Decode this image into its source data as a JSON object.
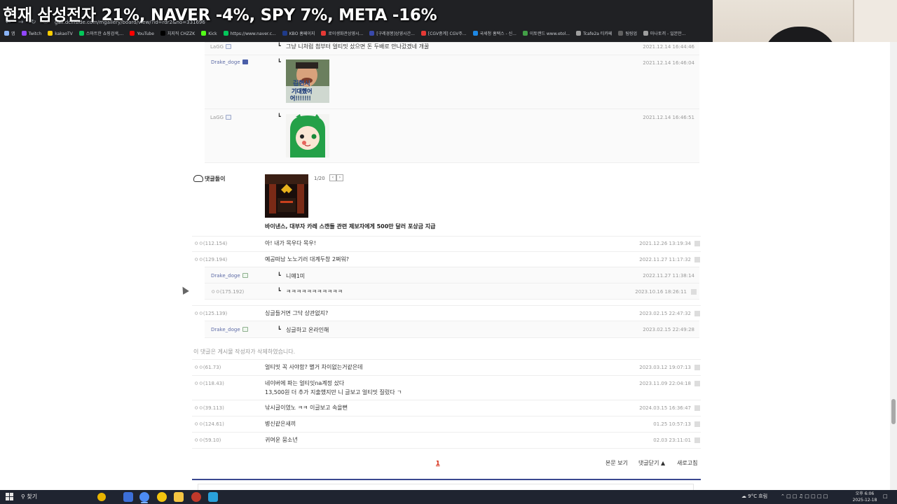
{
  "overlay": {
    "title": "현재 삼성전자 21%, NAVER -4%, SPY 7%, META -16%"
  },
  "browser": {
    "url": "gall.dcinside.com/mgallery/board/view/?id=rdr2&no=331696",
    "bookmarks": [
      {
        "label": "앱",
        "color": "#8ab4f8"
      },
      {
        "label": "Twitch",
        "color": "#9146ff"
      },
      {
        "label": "kakaoTV",
        "color": "#ffcd00"
      },
      {
        "label": "스마트한 쇼핑검색,...",
        "color": "#03c75a"
      },
      {
        "label": "YouTube",
        "color": "#ff0000"
      },
      {
        "label": "치지직 CHZZK",
        "color": "#000000"
      },
      {
        "label": "Kick",
        "color": "#53fc18"
      },
      {
        "label": "https://www.naver.c...",
        "color": "#03c75a"
      },
      {
        "label": "KBO 홈페이지",
        "color": "#1f3b8a"
      },
      {
        "label": "로이생화관상영시...",
        "color": "#e53935"
      },
      {
        "label": "[구레경봉]상영시간...",
        "color": "#3949ab"
      },
      {
        "label": "[CGV중계] CGV주...",
        "color": "#e53935"
      },
      {
        "label": "국세청 홈택스 - 신...",
        "color": "#1e88e5"
      },
      {
        "label": "이토랜드 www.etol...",
        "color": "#43a047"
      },
      {
        "label": "Tcafe2a 티카페",
        "color": "#9e9e9e"
      },
      {
        "label": "팀링업",
        "color": "#616161"
      },
      {
        "label": "마나토끼 - 일본만...",
        "color": "#9e9e9e"
      }
    ]
  },
  "thread_top": {
    "replies": [
      {
        "nick": "LaGG",
        "text": "그냥 니처럼 첨부터 얼티밋 샀으면 돈 두배로 안나갔겠네 개꿀",
        "date": "2021.12.14 16:44:46"
      },
      {
        "nick": "Drake_doge",
        "text": "",
        "date": "2021.12.14 16:46:04",
        "image": "meme-face"
      },
      {
        "nick": "LaGG",
        "text": "",
        "date": "2021.12.14 16:46:51",
        "image": "green-character"
      }
    ]
  },
  "dc_ad": {
    "label": "댓글돌이",
    "counter": "1/20",
    "caption": "바이낸스, 대부자 카레 스캔들 관련 제보자에게 500만 달러 포상금 지급"
  },
  "comments": [
    {
      "nick": "ㅇㅇ(112.154)",
      "text": "아! 내가 목우다 목우!",
      "date": "2021.12.26 13:19:34"
    },
    {
      "nick": "ㅇㅇ(129.194)",
      "text": "예공떠남 노노기러 대계두창 2쩌워?",
      "date": "2022.11.27 11:17:32",
      "replies": [
        {
          "nick": "Drake_doge",
          "text": "니얘1미",
          "date": "2022.11.27 11:38:14"
        },
        {
          "nick": "ㅇㅇ(175.192)",
          "text": "ㅋㅋㅋㅋㅋㅋㅋㅋㅋㅋㅋ",
          "date": "2023.10.16 18:26:11"
        }
      ]
    },
    {
      "nick": "ㅇㅇ(125.139)",
      "text": "싱글들거면 그닥 상관없지?",
      "date": "2023.02.15 22:47:32",
      "replies": [
        {
          "nick": "Drake_doge",
          "text": "싱글하고 온라인해",
          "date": "2023.02.15 22:49:28"
        }
      ]
    },
    {
      "deleted": "이 댓글은 게시물 작성자가 삭제하였습니다."
    },
    {
      "nick": "ㅇㅇ(61.73)",
      "text": "얼티밋 꼭 사야함? 별거 차이없는거같은데",
      "date": "2023.03.12 19:07:13"
    },
    {
      "nick": "ㅇㅇ(118.43)",
      "text": "네이버에 파는 얼티잇na계정 샀다",
      "text2": "13,500원 더 추가 지출했지만 니 글보고 얼티밋 질렀다 ㄱ",
      "date": "2023.11.09 22:04:18"
    },
    {
      "nick": "ㅇㅇ(39.113)",
      "text": "낚시글이였노 ㅋㅋ 이글보고 속을뻔",
      "date": "2024.03.15 16:36:47"
    },
    {
      "nick": "ㅇㅇ(124.61)",
      "text": "병신같은새끼",
      "date": "01.25 10:57:13"
    },
    {
      "nick": "ㅇㅇ(59.10)",
      "text": "귀여운 뭄소년",
      "date": "02.03 23:11:01"
    }
  ],
  "footer": {
    "page": "1",
    "view_post": "본문 보기",
    "collapse": "댓글닫기 ▲",
    "refresh": "새로고침"
  },
  "taskbar": {
    "search_label": "찾기",
    "weather": "9°C 흐림",
    "time": "오후 6:06",
    "date": "2025-12-18"
  }
}
